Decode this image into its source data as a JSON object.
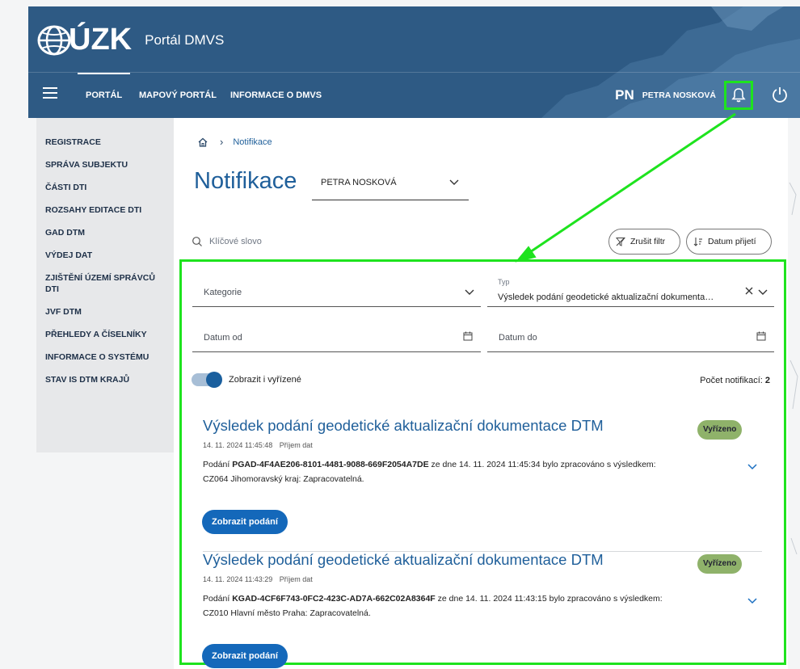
{
  "colors": {
    "header_bg": "#2e5a84",
    "accent": "#1f5f9a",
    "primary_button": "#1468ba",
    "badge_bg": "#8fb26a",
    "highlight": "#1ee31e"
  },
  "brand": {
    "logo_text": "ÚZK",
    "portal_name": "Portál DMVS"
  },
  "nav": {
    "items": [
      {
        "label": "PORTÁL"
      },
      {
        "label": "MAPOVÝ PORTÁL"
      },
      {
        "label": "INFORMACE O DMVS"
      }
    ]
  },
  "user": {
    "initials": "PN",
    "name": "PETRA NOSKOVÁ"
  },
  "sidebar": {
    "items": [
      {
        "label": "REGISTRACE"
      },
      {
        "label": "SPRÁVA SUBJEKTU"
      },
      {
        "label": "ČÁSTI DTI"
      },
      {
        "label": "ROZSAHY EDITACE DTI"
      },
      {
        "label": "GAD DTM"
      },
      {
        "label": "VÝDEJ DAT"
      },
      {
        "label": "ZJIŠTĚNÍ ÚZEMÍ SPRÁVCŮ DTI"
      },
      {
        "label": "JVF DTM"
      },
      {
        "label": "PŘEHLEDY A ČÍSELNÍKY"
      },
      {
        "label": "INFORMACE O SYSTÉMU"
      },
      {
        "label": "STAV IS DTM KRAJŮ"
      }
    ]
  },
  "breadcrumb": {
    "current": "Notifikace"
  },
  "page": {
    "title": "Notifikace",
    "user_select_value": "PETRA NOSKOVÁ"
  },
  "search": {
    "placeholder": "Klíčové slovo"
  },
  "buttons": {
    "clear_filter": "Zrušit filtr",
    "sort_date": "Datum přijetí"
  },
  "filters": {
    "category_label": "Kategorie",
    "type_label": "Typ",
    "type_value": "Výsledek podání geodetické aktualizační dokumentace DTM",
    "date_from_label": "Datum od",
    "date_to_label": "Datum do",
    "show_resolved_label": "Zobrazit i vyřízené",
    "show_resolved": true
  },
  "count": {
    "label": "Počet notifikací:",
    "value": "2"
  },
  "notifications": [
    {
      "title": "Výsledek podání geodetické aktualizační dokumentace DTM",
      "badge": "Vyřízeno",
      "date": "14. 11. 2024 11:45:48",
      "type": "Příjem dat",
      "prefix": "Podání",
      "id": "PGAD-4F4AE206-8101-4481-9088-669F2054A7DE",
      "suffix": "ze dne 14. 11. 2024 11:45:34 bylo zpracováno s výsledkem:",
      "result": "CZ064 Jihomoravský kraj: Zapracovatelná.",
      "button": "Zobrazit podání"
    },
    {
      "title": "Výsledek podání geodetické aktualizační dokumentace DTM",
      "badge": "Vyřízeno",
      "date": "14. 11. 2024 11:43:29",
      "type": "Příjem dat",
      "prefix": "Podání",
      "id": "KGAD-4CF6F743-0FC2-423C-AD7A-662C02A8364F",
      "suffix": "ze dne 14. 11. 2024 11:43:15 bylo zpracováno s výsledkem:",
      "result": "CZ010 Hlavní město Praha: Zapracovatelná.",
      "button": "Zobrazit podání"
    }
  ]
}
